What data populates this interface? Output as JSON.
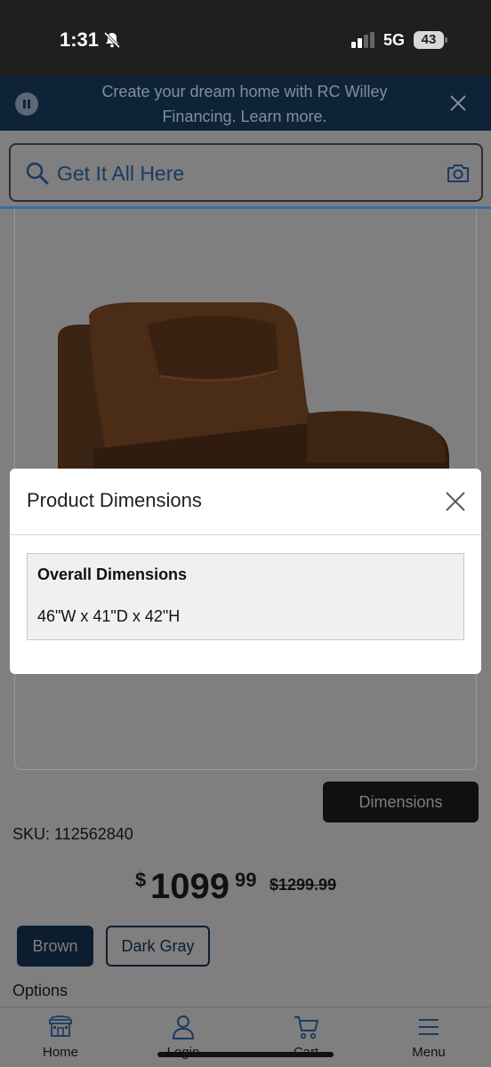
{
  "status_bar": {
    "time": "1:31",
    "network": "5G",
    "battery": "43"
  },
  "promo": {
    "text": "Create your dream home with RC Willey Financing. Learn more."
  },
  "search": {
    "placeholder": "Get It All Here"
  },
  "product": {
    "dimensions_button": "Dimensions",
    "sku": "SKU: 112562840",
    "price": {
      "dollar_sign": "$",
      "main": "1099",
      "cents": "99"
    },
    "old_price": "$1299.99",
    "colors": [
      "Brown",
      "Dark Gray"
    ],
    "options_label": "Options"
  },
  "modal": {
    "title": "Product Dimensions",
    "section_heading": "Overall Dimensions",
    "section_value": "46\"W x 41\"D x 42\"H"
  },
  "bottom_nav": {
    "items": [
      {
        "label": "Home",
        "icon": "store-icon"
      },
      {
        "label": "Login",
        "icon": "user-icon"
      },
      {
        "label": "Cart",
        "icon": "cart-icon"
      },
      {
        "label": "Menu",
        "icon": "hamburger-icon"
      }
    ]
  },
  "colors": {
    "status_bar": "#1f1f1f",
    "promo_bg": "#0f2338",
    "overlay_gray": "#7f7f7f",
    "brand_navy": "#0c1d30",
    "link_blue": "#1a3a60"
  }
}
